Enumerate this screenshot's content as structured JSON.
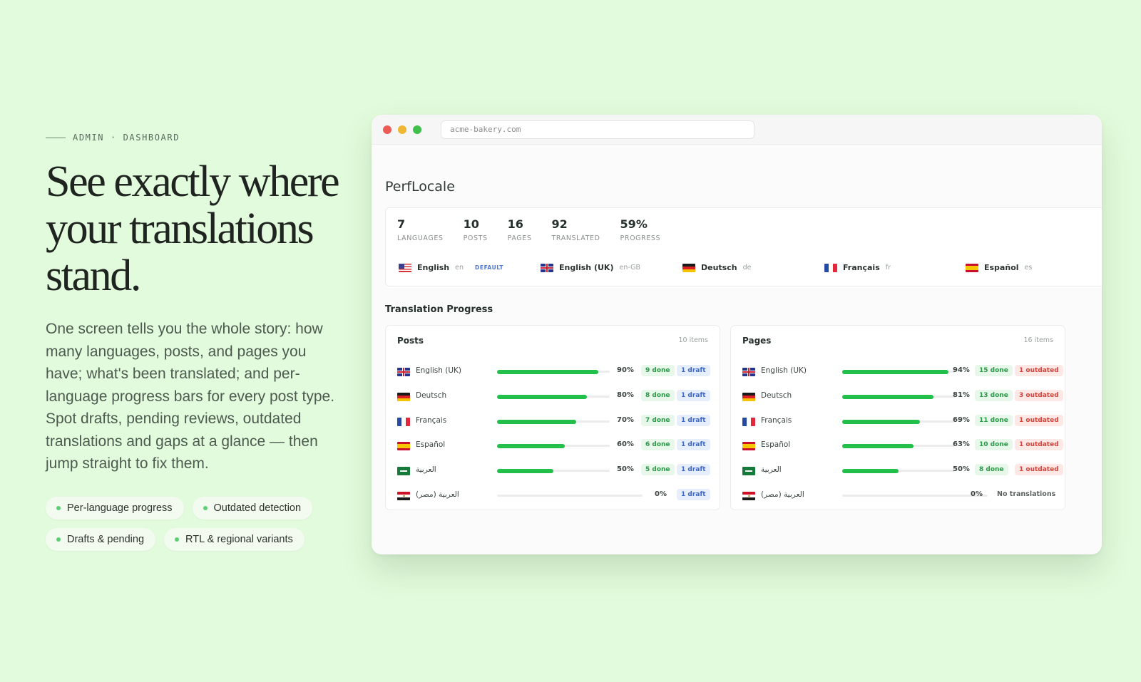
{
  "hero": {
    "eyebrow": "ADMIN · DASHBOARD",
    "headline": "See exactly where your translations stand.",
    "description": "One screen tells you the whole story: how many languages, posts, and pages you have; what's been translated; and per-language progress bars for every post type. Spot drafts, pending reviews, outdated translations and gaps at a glance — then jump straight to fix them.",
    "chips": [
      "Per-language progress",
      "Outdated detection",
      "Drafts & pending",
      "RTL & regional variants"
    ]
  },
  "browser": {
    "url": "acme-bakery.com"
  },
  "app": {
    "title": "PerfLocale",
    "stats": [
      {
        "value": "7",
        "label": "LANGUAGES"
      },
      {
        "value": "10",
        "label": "POSTS"
      },
      {
        "value": "16",
        "label": "PAGES"
      },
      {
        "value": "92",
        "label": "TRANSLATED"
      },
      {
        "value": "59%",
        "label": "PROGRESS"
      }
    ],
    "languages": [
      {
        "name": "English",
        "code": "en",
        "flag": "flag-us",
        "badge": "DEFAULT"
      },
      {
        "name": "English (UK)",
        "code": "en-GB",
        "flag": "flag-gb"
      },
      {
        "name": "Deutsch",
        "code": "de",
        "flag": "flag-de"
      },
      {
        "name": "Français",
        "code": "fr",
        "flag": "flag-fr"
      },
      {
        "name": "Español",
        "code": "es",
        "flag": "flag-es"
      }
    ],
    "section_title": "Translation Progress",
    "panels": {
      "posts": {
        "title": "Posts",
        "count": "10 items",
        "rows": [
          {
            "flag": "flag-gb",
            "name": "English (UK)",
            "progress": 0.9,
            "pct": "90%",
            "done": "9 done",
            "status": "1 draft",
            "status_kind": "draft"
          },
          {
            "flag": "flag-de",
            "name": "Deutsch",
            "progress": 0.8,
            "pct": "80%",
            "done": "8 done",
            "status": "1 draft",
            "status_kind": "draft"
          },
          {
            "flag": "flag-fr",
            "name": "Français",
            "progress": 0.7,
            "pct": "70%",
            "done": "7 done",
            "status": "1 draft",
            "status_kind": "draft"
          },
          {
            "flag": "flag-es",
            "name": "Español",
            "progress": 0.6,
            "pct": "60%",
            "done": "6 done",
            "status": "1 draft",
            "status_kind": "draft"
          },
          {
            "flag": "flag-sa",
            "name": "العربية",
            "progress": 0.5,
            "pct": "50%",
            "done": "5 done",
            "status": "1 draft",
            "status_kind": "draft"
          },
          {
            "flag": "flag-eg",
            "name": "العربية (مصر)",
            "progress": 0,
            "pct": "0%",
            "done": "",
            "status": "1 draft",
            "status_kind": "draft"
          }
        ]
      },
      "pages": {
        "title": "Pages",
        "count": "16 items",
        "rows": [
          {
            "flag": "flag-gb",
            "name": "English (UK)",
            "progress": 0.94,
            "pct": "94%",
            "done": "15 done",
            "status": "1 outdated",
            "status_kind": "outdated"
          },
          {
            "flag": "flag-de",
            "name": "Deutsch",
            "progress": 0.81,
            "pct": "81%",
            "done": "13 done",
            "status": "3 outdated",
            "status_kind": "outdated"
          },
          {
            "flag": "flag-fr",
            "name": "Français",
            "progress": 0.69,
            "pct": "69%",
            "done": "11 done",
            "status": "1 outdated",
            "status_kind": "outdated"
          },
          {
            "flag": "flag-es",
            "name": "Español",
            "progress": 0.63,
            "pct": "63%",
            "done": "10 done",
            "status": "1 outdated",
            "status_kind": "outdated"
          },
          {
            "flag": "flag-sa",
            "name": "العربية",
            "progress": 0.5,
            "pct": "50%",
            "done": "8 done",
            "status": "1 outdated",
            "status_kind": "outdated"
          },
          {
            "flag": "flag-eg",
            "name": "العربية (مصر)",
            "progress": 0,
            "pct": "0%",
            "done": "",
            "status": "No translations",
            "status_kind": "none"
          }
        ]
      }
    }
  },
  "colors": {
    "background": "#e2fbdc",
    "progress_fill": "#22c04b",
    "draft_badge": "#3d68c7",
    "outdated_badge": "#d2443a",
    "default_badge": "#4d76d6"
  }
}
